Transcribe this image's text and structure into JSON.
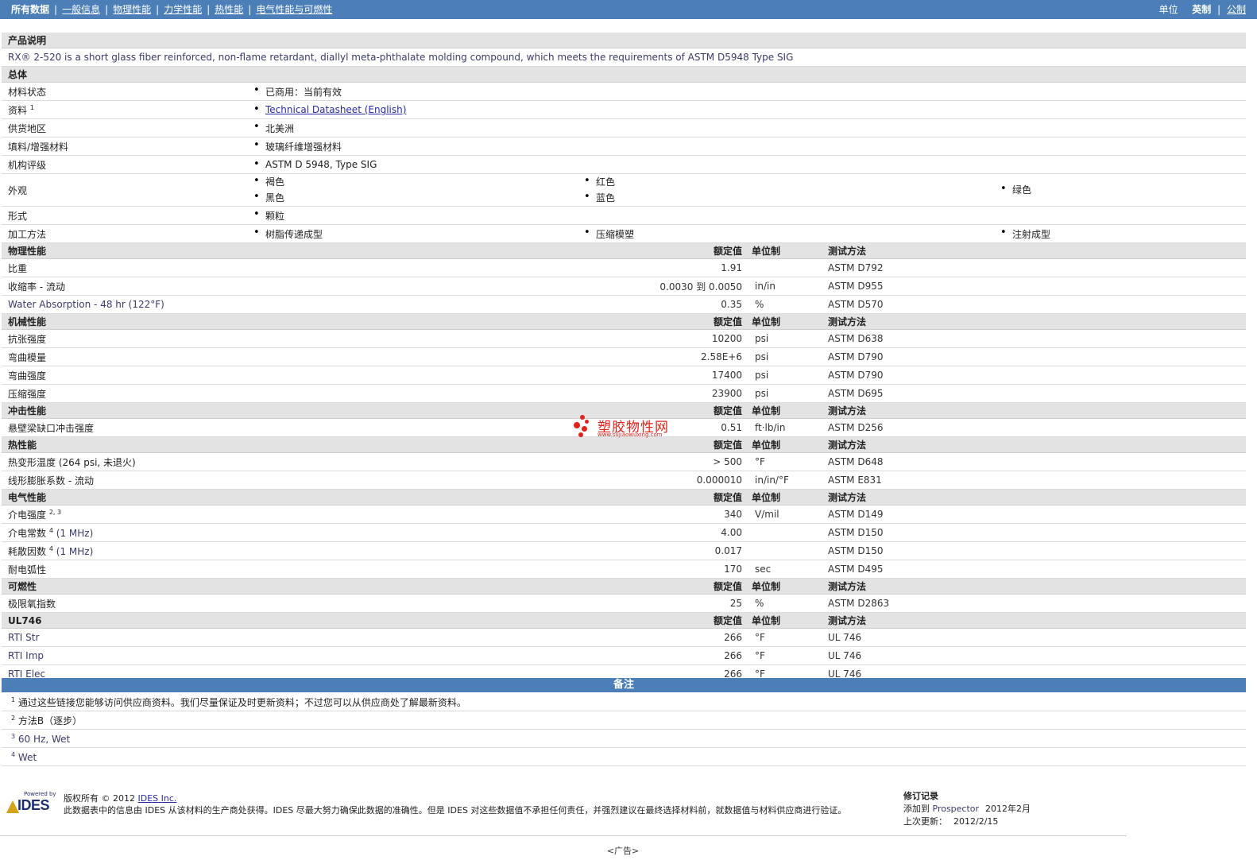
{
  "nav": {
    "items": [
      "所有数据",
      "一般信息",
      "物理性能",
      "力学性能",
      "热性能",
      "电气性能与可燃性"
    ],
    "unit_label": "单位",
    "unit_english": "英制",
    "unit_metric": "公制"
  },
  "product": {
    "heading": "产品说明",
    "description": "RX® 2-520 is a short glass fiber reinforced, non-flame retardant, diallyl meta-phthalate molding compound, which meets the requirements of ASTM D5948 Type SIG"
  },
  "general": {
    "heading": "总体",
    "rows": [
      {
        "label": "材料状态",
        "values": [
          "已商用：当前有效"
        ]
      },
      {
        "label": "资料",
        "sup": "1",
        "link": "Technical Datasheet (English)"
      },
      {
        "label": "供货地区",
        "values": [
          "北美洲"
        ]
      },
      {
        "label": "填料/增强材料",
        "values": [
          "玻璃纤维增强材料"
        ]
      },
      {
        "label": "机构评级",
        "values": [
          "ASTM D 5948, Type SIG"
        ]
      },
      {
        "label": "外观",
        "values": [
          "褐色",
          "红色",
          "绿色",
          "黑色",
          "蓝色"
        ]
      },
      {
        "label": "形式",
        "values": [
          "颗粒"
        ]
      },
      {
        "label": "加工方法",
        "values": [
          "树脂传递成型",
          "压缩模塑",
          "注射成型"
        ]
      }
    ]
  },
  "headers": {
    "rated": "额定值",
    "unit": "单位制",
    "method": "测试方法"
  },
  "sections": [
    {
      "title": "物理性能",
      "rows": [
        {
          "label": "比重",
          "value": "1.91",
          "unit": "",
          "method": "ASTM D792"
        },
        {
          "label": "收缩率 - 流动",
          "value": "0.0030 到  0.0050",
          "unit": "in/in",
          "method": "ASTM D955"
        },
        {
          "label": "Water Absorption - 48 hr (122°F)",
          "value": "0.35",
          "unit": "%",
          "method": "ASTM D570",
          "en": true
        }
      ]
    },
    {
      "title": "机械性能",
      "rows": [
        {
          "label": "抗张强度",
          "value": "10200",
          "unit": "psi",
          "method": "ASTM D638"
        },
        {
          "label": "弯曲模量",
          "value": "2.58E+6",
          "unit": "psi",
          "method": "ASTM D790"
        },
        {
          "label": "弯曲强度",
          "value": "17400",
          "unit": "psi",
          "method": "ASTM D790"
        },
        {
          "label": "压缩强度",
          "value": "23900",
          "unit": "psi",
          "method": "ASTM D695"
        }
      ]
    },
    {
      "title": "冲击性能",
      "rows": [
        {
          "label": "悬壁梁缺口冲击强度",
          "value": "0.51",
          "unit": "ft·lb/in",
          "method": "ASTM D256"
        }
      ]
    },
    {
      "title": "热性能",
      "rows": [
        {
          "label": "热变形温度 (264 psi, 未退火)",
          "value": "> 500",
          "unit": "°F",
          "method": "ASTM D648"
        },
        {
          "label": "线形膨胀系数 - 流动",
          "value": "0.000010",
          "unit": "in/in/°F",
          "method": "ASTM E831"
        }
      ]
    },
    {
      "title": "电气性能",
      "rows": [
        {
          "label": "介电强度",
          "sup": "2, 3",
          "value": "340",
          "unit": "V/mil",
          "method": "ASTM D149"
        },
        {
          "label": "介电常数",
          "sup": "4",
          "suffix": "(1 MHz)",
          "value": "4.00",
          "unit": "",
          "method": "ASTM D150"
        },
        {
          "label": "耗散因数",
          "sup": "4",
          "suffix": "(1 MHz)",
          "value": "0.017",
          "unit": "",
          "method": "ASTM D150"
        },
        {
          "label": "耐电弧性",
          "value": "170",
          "unit": "sec",
          "method": "ASTM D495"
        }
      ]
    },
    {
      "title": "可燃性",
      "rows": [
        {
          "label": "极限氧指数",
          "value": "25",
          "unit": "%",
          "method": "ASTM D2863"
        }
      ]
    },
    {
      "title": "UL746",
      "rows": [
        {
          "label": "RTI Str",
          "value": "266",
          "unit": "°F",
          "method": "UL 746",
          "en": true
        },
        {
          "label": "RTI Imp",
          "value": "266",
          "unit": "°F",
          "method": "UL 746",
          "en": true
        },
        {
          "label": "RTI Elec",
          "value": "266",
          "unit": "°F",
          "method": "UL 746",
          "en": true
        }
      ]
    }
  ],
  "notes": {
    "title": "备注",
    "items": [
      {
        "num": "1",
        "text": "通过这些链接您能够访问供应商资料。我们尽量保证及时更新资料；不过您可以从供应商处了解最新资料。"
      },
      {
        "num": "2",
        "text": "方法B（逐步）"
      },
      {
        "num": "3",
        "text": "60 Hz, Wet"
      },
      {
        "num": "4",
        "text": "Wet"
      }
    ]
  },
  "footer": {
    "powered_by": "Powered by",
    "logo_text": "IDES",
    "copyright_prefix": "版权所有 © 2012 ",
    "copyright_link": "IDES Inc.",
    "disclaimer": "此数据表中的信息由 IDES 从该材料的生产商处获得。IDES 尽最大努力确保此数据的准确性。但是 IDES 对这些数据值不承担任何责任，并强烈建议在最终选择材料前，就数据值与材料供应商进行验证。",
    "revision_title": "修订记录",
    "added_label": "添加到",
    "added_link": "Prospector",
    "added_date": "2012年2月",
    "updated_label": "上次更新：",
    "updated_date": "2012/2/15",
    "ad": "<广告>"
  },
  "watermark": {
    "text": "塑胶物性网",
    "url": "www.sujiaowuxing.com",
    "color": "#e2231a"
  }
}
